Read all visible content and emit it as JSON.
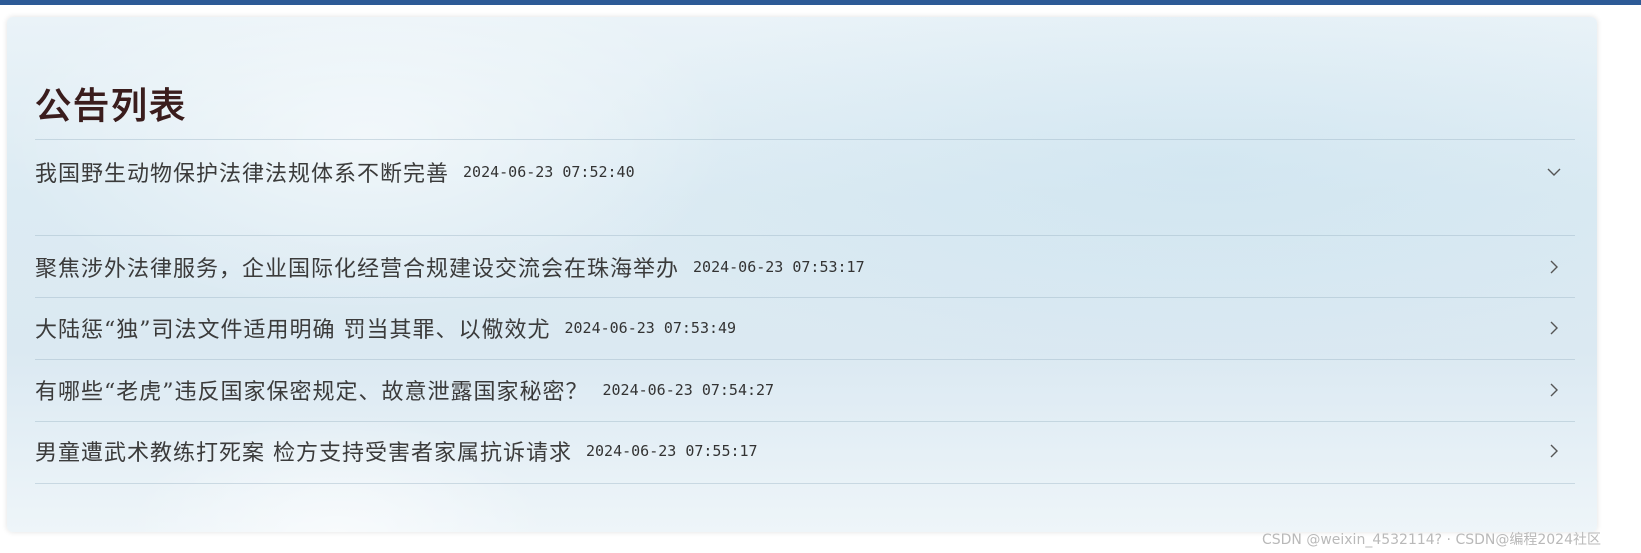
{
  "panel": {
    "title": "公告列表"
  },
  "announcements": [
    {
      "title": "我国野生动物保护法律法规体系不断完善",
      "time": "2024-06-23 07:52:40",
      "expanded": true,
      "icon": "chevron-down-icon"
    },
    {
      "title": "聚焦涉外法律服务，企业国际化经营合规建设交流会在珠海举办",
      "time": "2024-06-23 07:53:17",
      "expanded": false,
      "icon": "chevron-right-icon"
    },
    {
      "title": "大陆惩“独”司法文件适用明确 罚当其罪、以儆效尤",
      "time": "2024-06-23 07:53:49",
      "expanded": false,
      "icon": "chevron-right-icon"
    },
    {
      "title": "有哪些“老虎”违反国家保密规定、故意泄露国家秘密？",
      "time": "2024-06-23 07:54:27",
      "expanded": false,
      "icon": "chevron-right-icon"
    },
    {
      "title": "男童遭武术教练打死案 检方支持受害者家属抗诉请求",
      "time": "2024-06-23 07:55:17",
      "expanded": false,
      "icon": "chevron-right-icon"
    }
  ],
  "watermark": "CSDN @weixin_4532114? · CSDN@编程2024社区",
  "colors": {
    "top_bar": "#2d5a96",
    "title": "#3a1d1d",
    "text": "#3b3b3b"
  }
}
